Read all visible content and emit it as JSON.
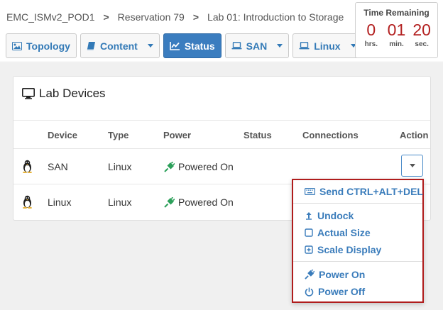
{
  "breadcrumb": {
    "items": [
      "EMC_ISMv2_POD1",
      "Reservation 79",
      "Lab 01: Introduction to Storage"
    ],
    "separator": ">"
  },
  "toolbar": {
    "topology": "Topology",
    "content": "Content",
    "status": "Status",
    "san": "SAN",
    "linux": "Linux"
  },
  "timer": {
    "title": "Time Remaining",
    "hours": "0",
    "minutes": "01",
    "seconds": "20",
    "hours_unit": "hrs.",
    "minutes_unit": "min.",
    "seconds_unit": "sec."
  },
  "lab_devices": {
    "title": "Lab Devices",
    "columns": {
      "device": "Device",
      "type": "Type",
      "power": "Power",
      "status": "Status",
      "connections": "Connections",
      "action": "Action"
    },
    "rows": [
      {
        "device": "SAN",
        "type": "Linux",
        "power": "Powered On",
        "status": "",
        "connections": ""
      },
      {
        "device": "Linux",
        "type": "Linux",
        "power": "Powered On",
        "status": "",
        "connections": ""
      }
    ]
  },
  "action_menu": {
    "send_keys": "Send CTRL+ALT+DEL",
    "undock": "Undock",
    "actual_size": "Actual Size",
    "scale_display": "Scale Display",
    "power_on": "Power On",
    "power_off": "Power Off"
  },
  "colors": {
    "accent": "#3a7cbb",
    "active_button": "#3b7dbf",
    "timer_digits": "#b32020",
    "power_on_icon": "#2ca05a",
    "menu_border": "#b01c1c"
  },
  "icons": {
    "topology": "image-icon",
    "content": "book-icon",
    "status": "line-chart-icon",
    "san": "laptop-icon",
    "linux": "laptop-icon",
    "lab_devices": "monitor-icon",
    "device_os": "linux-tux-icon",
    "power": "plug-icon",
    "send_keys": "keyboard-icon",
    "undock": "arrow-up-icon",
    "actual_size": "square-icon",
    "scale_display": "plus-square-icon",
    "power_on": "plug-icon",
    "power_off": "power-icon"
  }
}
